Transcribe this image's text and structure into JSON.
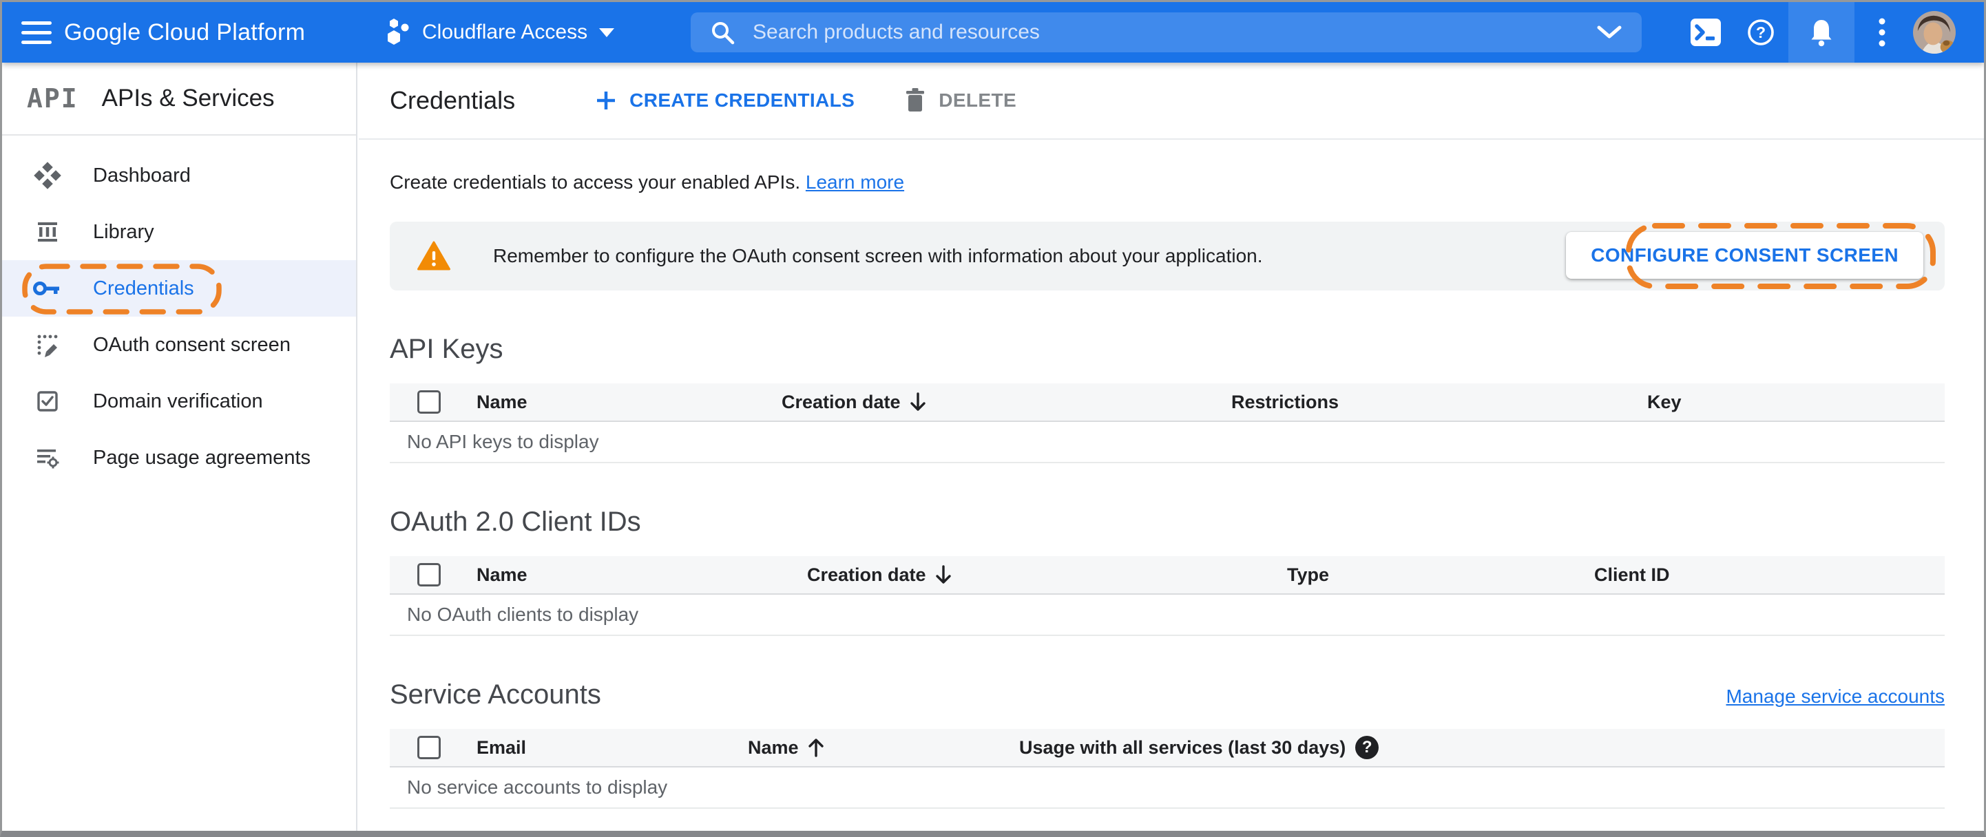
{
  "header": {
    "product_name": "Google Cloud Platform",
    "project_selector": "Cloudflare Access",
    "search_placeholder": "Search products and resources"
  },
  "sidebar": {
    "logo_text": "API",
    "title": "APIs & Services",
    "items": [
      {
        "label": "Dashboard",
        "icon": "dashboard-icon",
        "active": false
      },
      {
        "label": "Library",
        "icon": "library-icon",
        "active": false
      },
      {
        "label": "Credentials",
        "icon": "key-icon",
        "active": true,
        "annotated": true
      },
      {
        "label": "OAuth consent screen",
        "icon": "consent-screen-icon",
        "active": false
      },
      {
        "label": "Domain verification",
        "icon": "domain-verification-icon",
        "active": false
      },
      {
        "label": "Page usage agreements",
        "icon": "page-agreements-icon",
        "active": false
      }
    ]
  },
  "toolbar": {
    "title": "Credentials",
    "create_button": "CREATE CREDENTIALS",
    "delete_button": "DELETE"
  },
  "intro": {
    "text": "Create credentials to access your enabled APIs.",
    "link_label": "Learn more"
  },
  "consent_banner": {
    "message": "Remember to configure the OAuth consent screen with information about your application.",
    "action_button": "CONFIGURE CONSENT SCREEN"
  },
  "api_keys": {
    "title": "API Keys",
    "columns": [
      "Name",
      "Creation date",
      "Restrictions",
      "Key"
    ],
    "sort_column": "Creation date",
    "sort_direction": "descending",
    "empty_message": "No API keys to display"
  },
  "oauth_clients": {
    "title": "OAuth 2.0 Client IDs",
    "columns": [
      "Name",
      "Creation date",
      "Type",
      "Client ID"
    ],
    "sort_column": "Creation date",
    "sort_direction": "descending",
    "empty_message": "No OAuth clients to display"
  },
  "service_accounts": {
    "title": "Service Accounts",
    "manage_link": "Manage service accounts",
    "columns": [
      "Email",
      "Name",
      "Usage with all services (last 30 days)"
    ],
    "sort_column": "Name",
    "sort_direction": "ascending",
    "empty_message": "No service accounts to display",
    "help_badge": "?"
  },
  "colors": {
    "header_blue": "#1a73e8",
    "search_pill_blue": "#4a86ec",
    "link_blue": "#1a73e8",
    "annotation_orange": "#ee8227",
    "warning_orange": "#f28b05",
    "banner_gray": "#f1f3f4",
    "selected_item_bg": "#edf1fb"
  },
  "icons": {
    "menu": "hamburger-icon",
    "project": "project-hexagons-icon",
    "search": "search-icon",
    "search_expand": "chevron-down-icon",
    "cloud_shell": "cloud-shell-icon",
    "help": "help-icon",
    "notifications": "bell-icon",
    "more": "kebab-menu-icon",
    "account": "avatar",
    "create": "plus-icon",
    "delete": "trash-icon",
    "warning": "warning-triangle-icon",
    "sort_desc": "arrow-down-icon",
    "sort_asc": "arrow-up-icon",
    "column_help": "question-mark-icon"
  }
}
